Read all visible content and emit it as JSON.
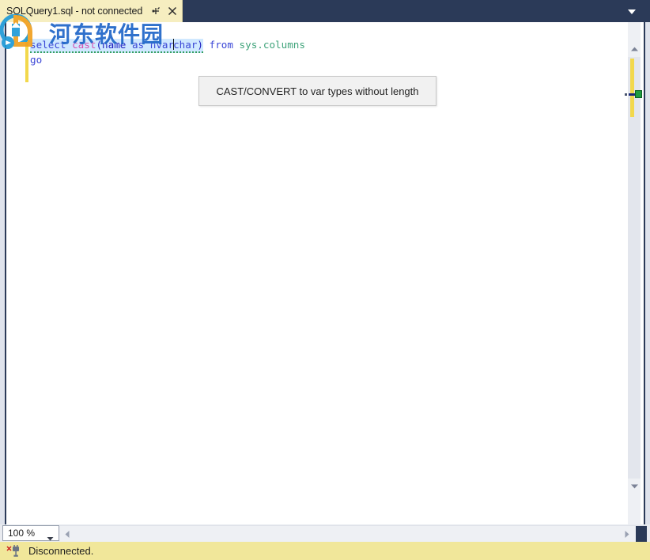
{
  "window": {
    "app": "SQL Server Management Studio Query Editor"
  },
  "tabbar": {
    "tab_title": "SQLQuery1.sql - not connected",
    "pin_icon": "pin-icon",
    "close_icon": "close-icon",
    "dropdown_icon": "chevron-down-icon"
  },
  "editor": {
    "split_icon": "split-view-icon",
    "lines": [
      {
        "id": "line1",
        "tokens": [
          {
            "text": "select",
            "type": "kw"
          },
          {
            "text": " ",
            "type": "plain"
          },
          {
            "text": "cast",
            "type": "fn"
          },
          {
            "text": "(",
            "type": "punct"
          },
          {
            "text": "name",
            "type": "ident"
          },
          {
            "text": " ",
            "type": "plain"
          },
          {
            "text": "as",
            "type": "kw"
          },
          {
            "text": " ",
            "type": "plain"
          },
          {
            "text": "nvarchar",
            "type": "kw"
          },
          {
            "text": ")",
            "type": "punct"
          },
          {
            "text": " ",
            "type": "plain"
          },
          {
            "text": "from",
            "type": "kw"
          },
          {
            "text": " ",
            "type": "plain"
          },
          {
            "text": "sys.columns",
            "type": "obj"
          }
        ]
      },
      {
        "id": "line2",
        "tokens": [
          {
            "text": "go",
            "type": "kw"
          }
        ]
      }
    ]
  },
  "tooltip": {
    "text": "CAST/CONVERT to var types without length"
  },
  "scrollbar": {
    "up_arrow_icon": "scroll-up-arrow-icon",
    "down_arrow_icon": "scroll-down-arrow-icon",
    "change_marker_color": "#f2d84c",
    "error_marker_color": "#1f9d3f"
  },
  "bottombar": {
    "zoom_level": "100 %",
    "zoom_caret_icon": "chevron-down-icon",
    "hscroll_left_icon": "scroll-left-arrow-icon",
    "hscroll_right_icon": "scroll-right-arrow-icon"
  },
  "statusbar": {
    "connection_icon": "disconnected-plug-icon",
    "text": "Disconnected.",
    "background_color": "#f1e79a"
  },
  "watermark": {
    "text": "河东软件园",
    "logo_icon": "site-logo-icon"
  }
}
